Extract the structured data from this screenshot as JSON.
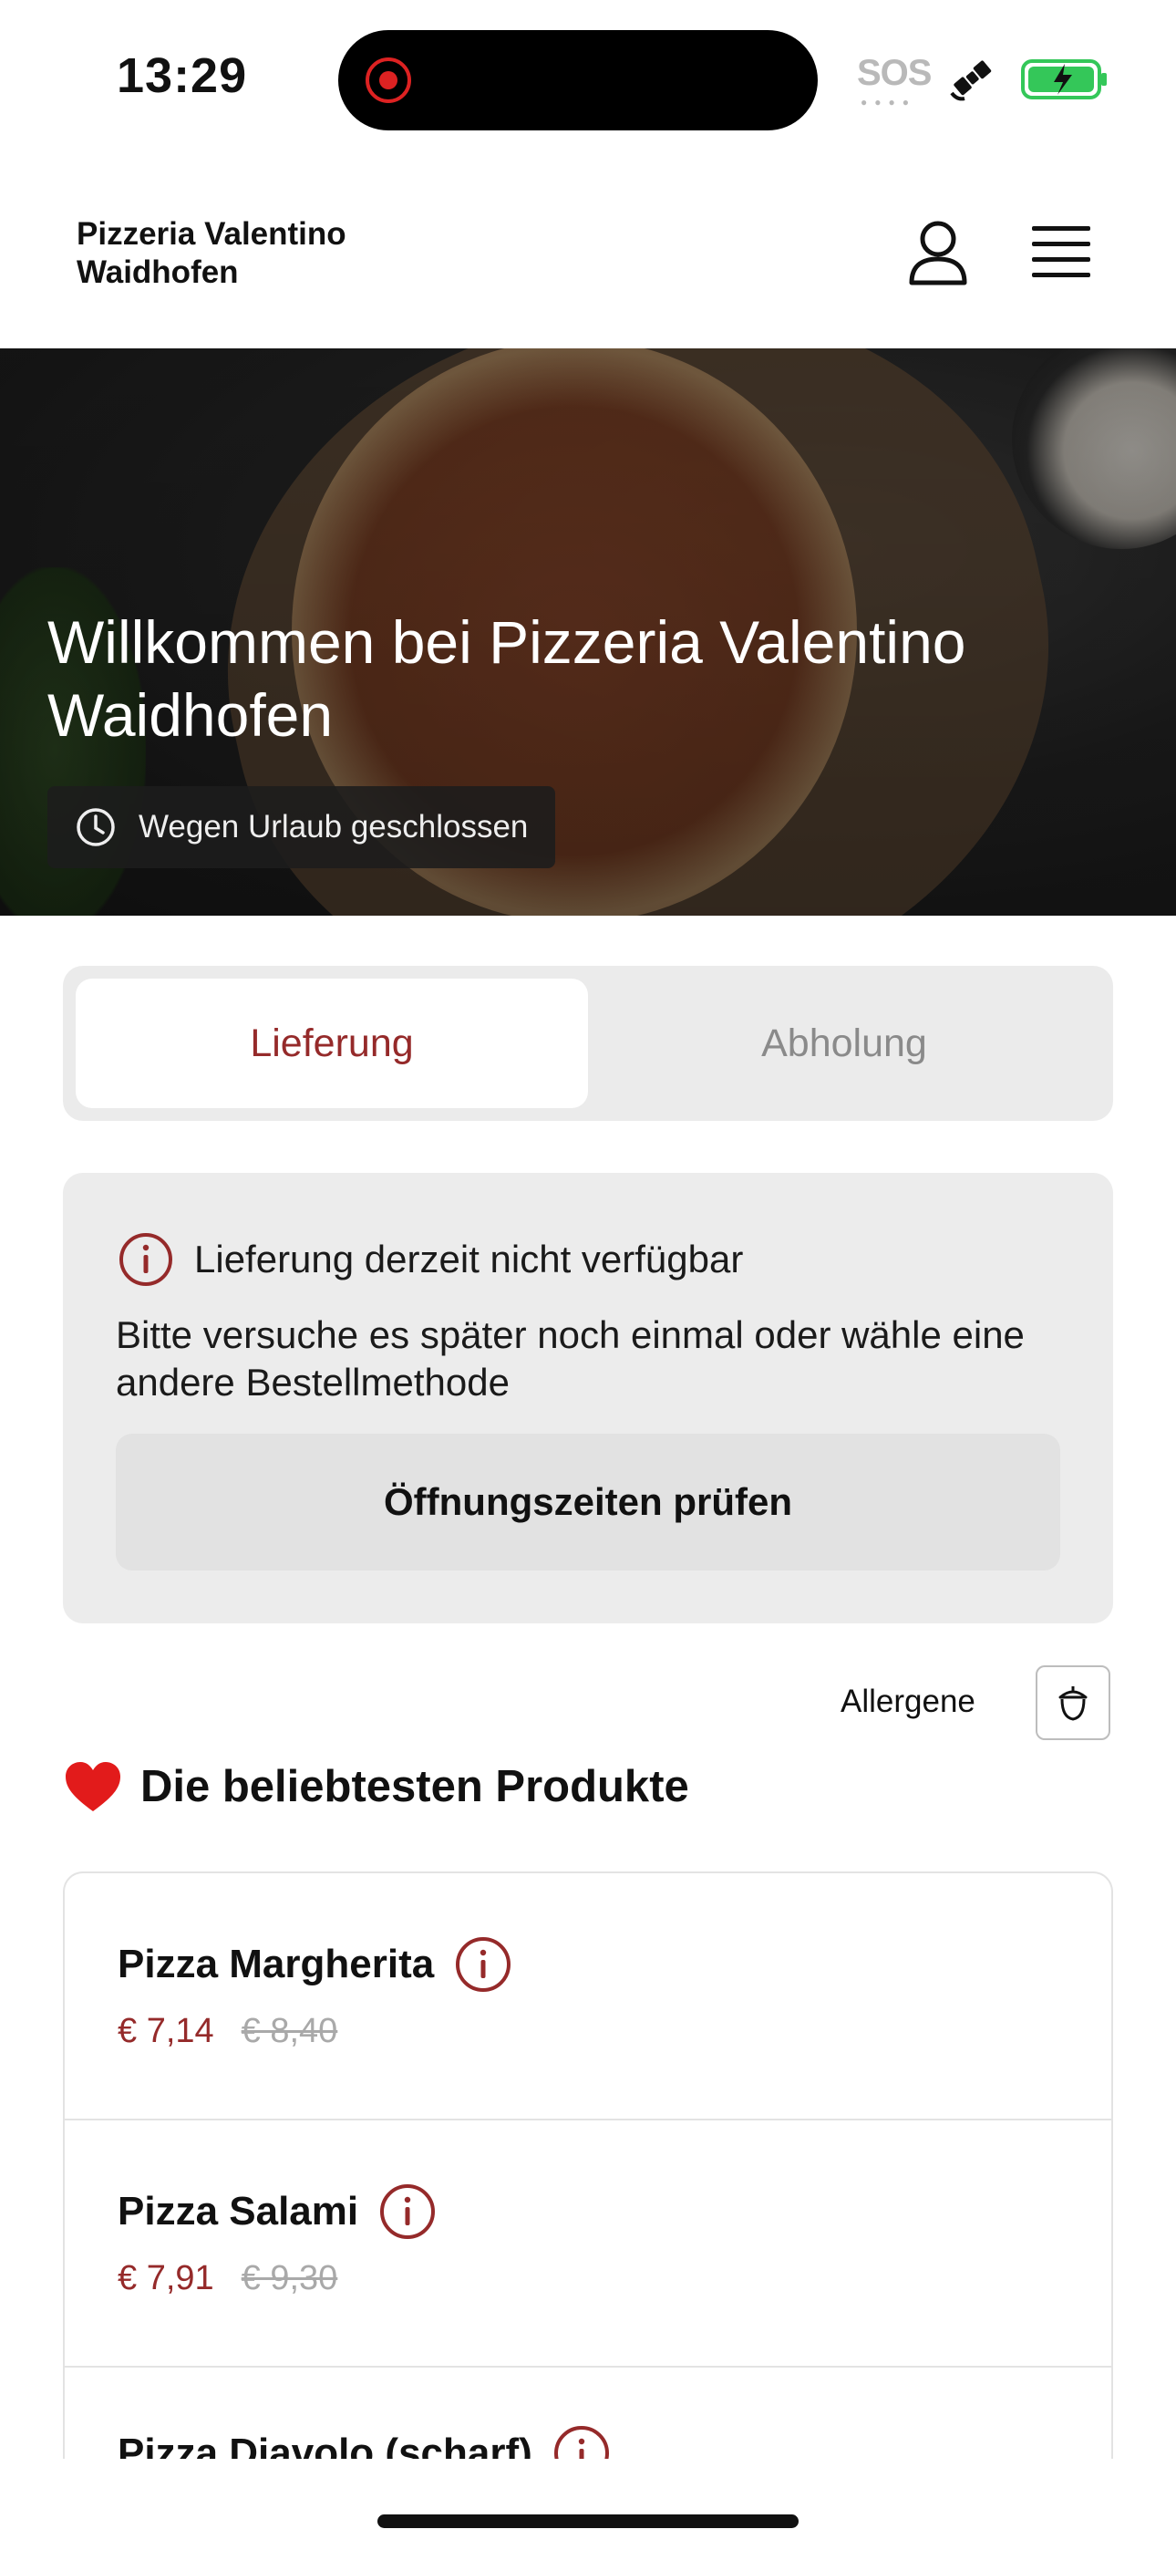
{
  "status_bar": {
    "time": "13:29",
    "sos": "SOS",
    "icons": [
      "screen-recording-icon",
      "satellite-icon",
      "battery-charging-icon"
    ]
  },
  "header": {
    "brand": "Pizzeria Valentino Waidhofen",
    "icons": [
      "account-icon",
      "hamburger-menu-icon"
    ]
  },
  "hero": {
    "title": "Willkommen bei Pizzeria Valentino Waidhofen",
    "badge": "Wegen Urlaub geschlossen",
    "badge_icon": "clock-icon"
  },
  "order_mode": {
    "options": [
      {
        "label": "Lieferung",
        "selected": true
      },
      {
        "label": "Abholung",
        "selected": false
      }
    ],
    "accent_color": "#952a2a"
  },
  "notice": {
    "icon": "info-icon",
    "title": "Lieferung derzeit nicht verfügbar",
    "text": "Bitte versuche es später noch einmal oder wähle eine andere Bestellmethode",
    "button": "Öffnungszeiten prüfen"
  },
  "allergens": {
    "label": "Allergene",
    "icon": "acorn-icon"
  },
  "popular": {
    "icon": "heart-icon",
    "title": "Die beliebtesten Produkte",
    "products": [
      {
        "name": "Pizza Margherita",
        "price": "€ 7,14",
        "old_price": "€ 8,40"
      },
      {
        "name": "Pizza Salami",
        "price": "€ 7,91",
        "old_price": "€ 9,30"
      },
      {
        "name": "Pizza Diavolo (scharf)"
      }
    ]
  },
  "colors": {
    "accent": "#952a2a",
    "card_bg": "#ececec",
    "muted": "#8a8a8a"
  }
}
